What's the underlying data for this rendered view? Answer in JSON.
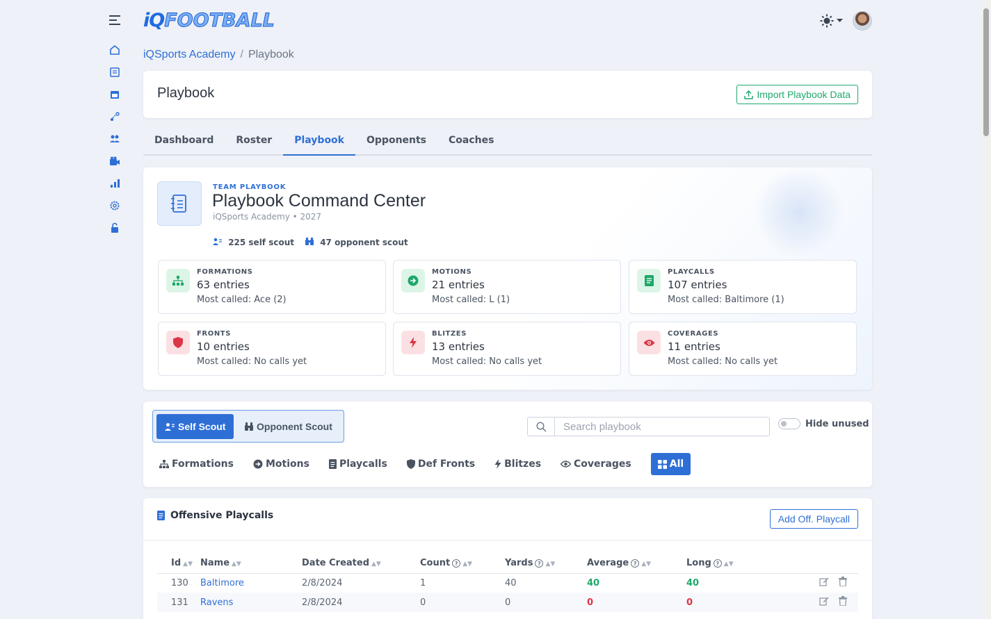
{
  "app": {
    "logo_iq": "iQ",
    "logo_football": "FOOTBALL"
  },
  "sidebar": {
    "items": [
      {
        "icon": "menu-icon"
      },
      {
        "icon": "home-icon"
      },
      {
        "icon": "notes-icon"
      },
      {
        "icon": "calendar-icon"
      },
      {
        "icon": "plays-icon"
      },
      {
        "icon": "users-icon"
      },
      {
        "icon": "camera-icon"
      },
      {
        "icon": "chart-icon"
      },
      {
        "icon": "gear-icon"
      },
      {
        "icon": "unlock-icon"
      }
    ]
  },
  "breadcrumb": {
    "parent": "iQSports Academy",
    "separator": "/",
    "current": "Playbook"
  },
  "header": {
    "title": "Playbook",
    "import_label": "Import Playbook Data"
  },
  "tabs": [
    {
      "label": "Dashboard"
    },
    {
      "label": "Roster"
    },
    {
      "label": "Playbook"
    },
    {
      "label": "Opponents"
    },
    {
      "label": "Coaches"
    }
  ],
  "command": {
    "eyebrow": "TEAM PLAYBOOK",
    "title": "Playbook Command Center",
    "subtitle": "iQSports Academy • 2027",
    "self_scout_count": "225 self scout",
    "opponent_scout_count": "47 opponent scout",
    "stats": [
      {
        "label": "FORMATIONS",
        "value": "63 entries",
        "most": "Most called: Ace (2)"
      },
      {
        "label": "MOTIONS",
        "value": "21 entries",
        "most": "Most called: L (1)"
      },
      {
        "label": "PLAYCALLS",
        "value": "107 entries",
        "most": "Most called: Baltimore (1)"
      },
      {
        "label": "FRONTS",
        "value": "10 entries",
        "most": "Most called: No calls yet"
      },
      {
        "label": "BLITZES",
        "value": "13 entries",
        "most": "Most called: No calls yet"
      },
      {
        "label": "COVERAGES",
        "value": "11 entries",
        "most": "Most called: No calls yet"
      }
    ]
  },
  "filters": {
    "self_scout": "Self Scout",
    "opponent_scout": "Opponent Scout",
    "search_placeholder": "Search playbook",
    "hide_unused": "Hide unused",
    "categories": [
      {
        "label": "Formations"
      },
      {
        "label": "Motions"
      },
      {
        "label": "Playcalls"
      },
      {
        "label": "Def Fronts"
      },
      {
        "label": "Blitzes"
      },
      {
        "label": "Coverages"
      },
      {
        "label": "All"
      }
    ]
  },
  "playcalls": {
    "title": "Offensive Playcalls",
    "add_label": "Add Off. Playcall",
    "columns": [
      "Id",
      "Name",
      "Date Created",
      "Count",
      "Yards",
      "Average",
      "Long"
    ],
    "rows": [
      {
        "id": "130",
        "name": "Baltimore",
        "date": "2/8/2024",
        "count": "1",
        "yards": "40",
        "average": "40",
        "long": "40"
      },
      {
        "id": "131",
        "name": "Ravens",
        "date": "2/8/2024",
        "count": "0",
        "yards": "0",
        "average": "0",
        "long": "0"
      }
    ]
  }
}
